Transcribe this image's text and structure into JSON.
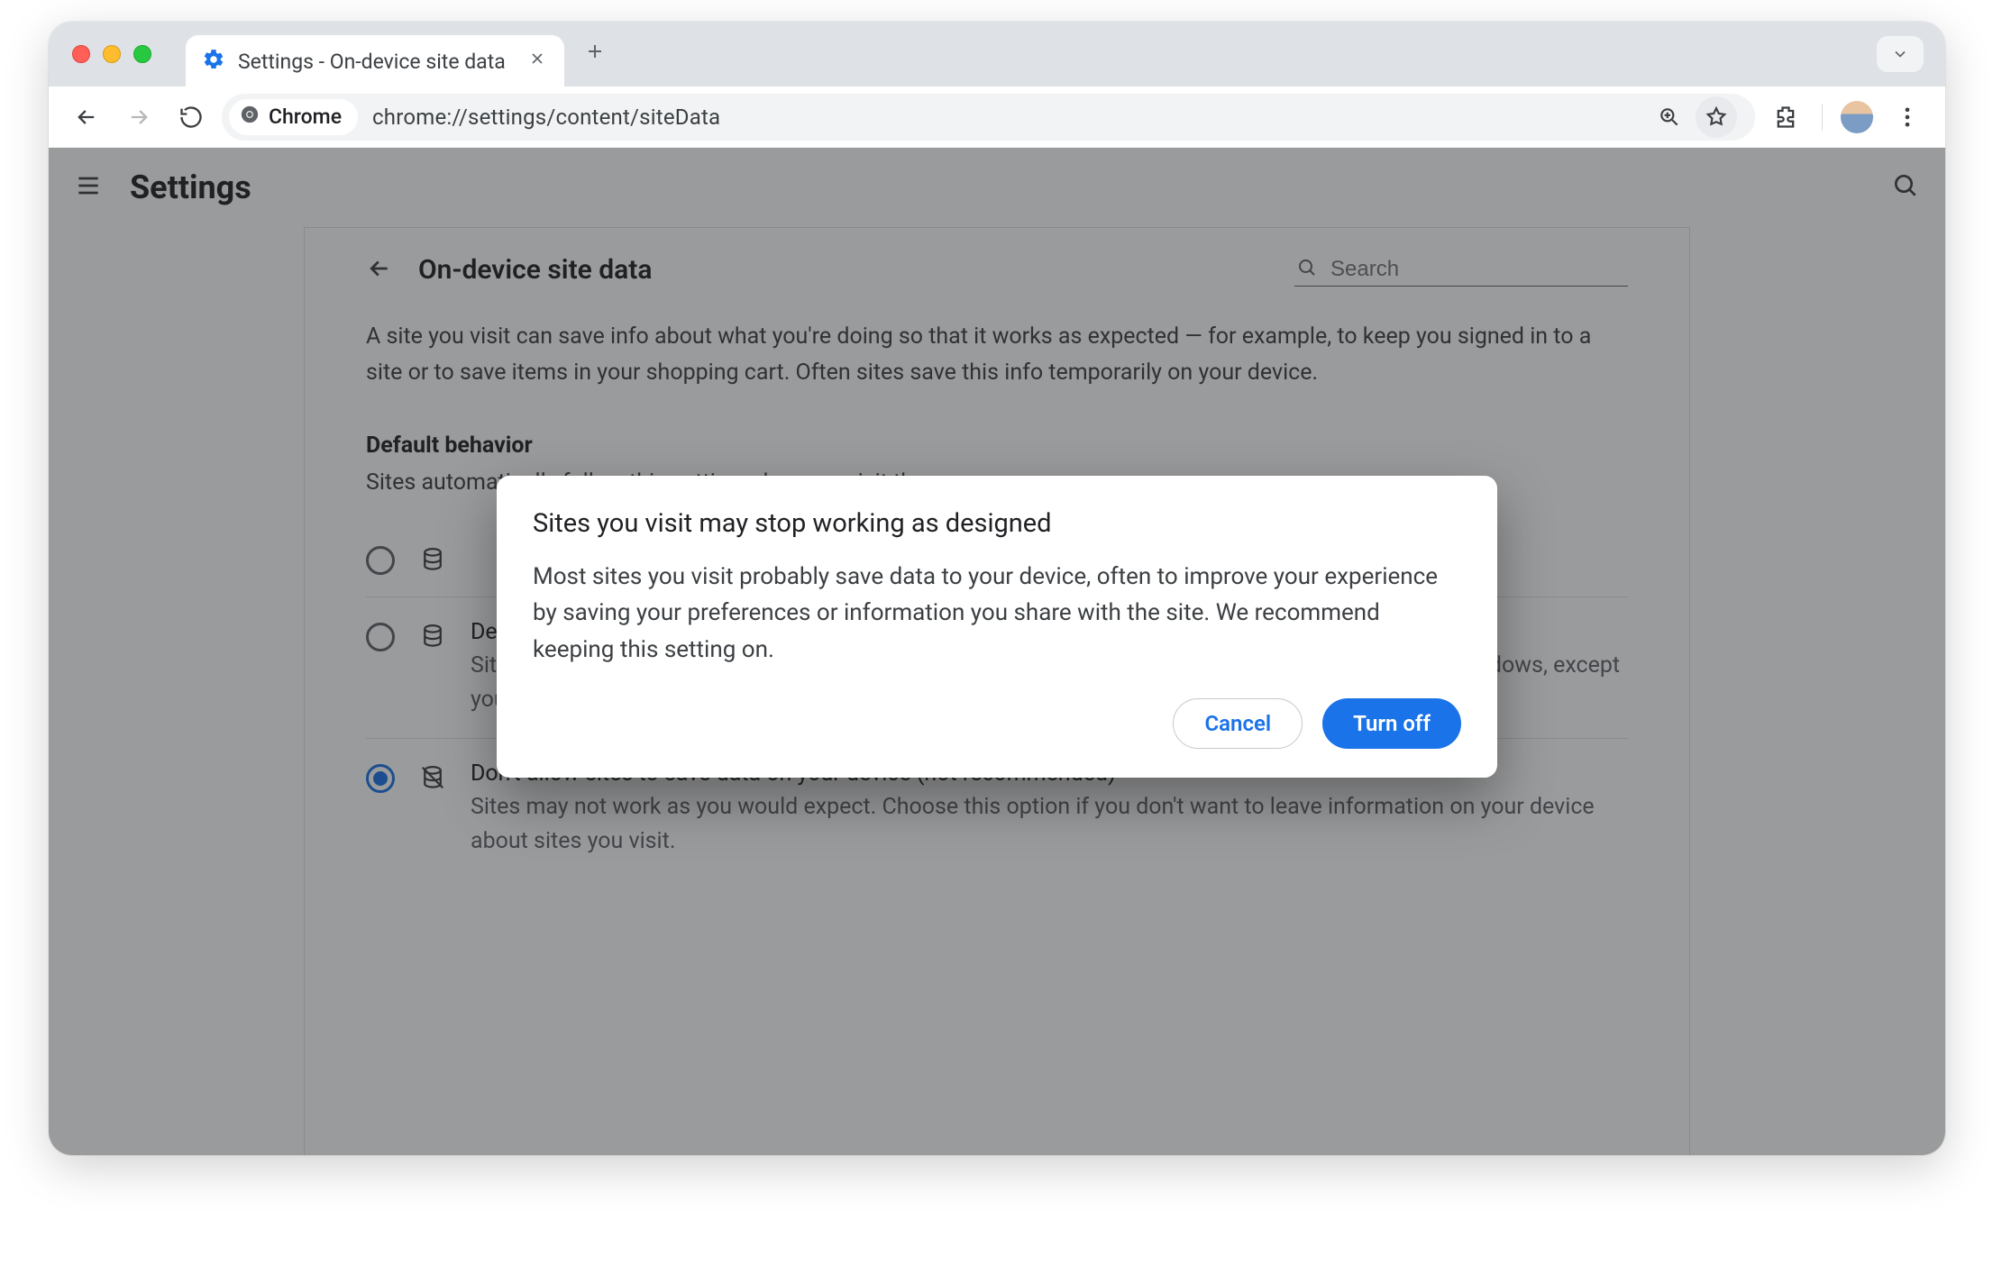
{
  "window": {
    "tab_title": "Settings - On-device site data",
    "url": "chrome://settings/content/siteData",
    "omnibox_chip": "Chrome"
  },
  "appbar": {
    "title": "Settings"
  },
  "page": {
    "title": "On-device site data",
    "search_placeholder": "Search",
    "intro": "A site you visit can save info about what you're doing so that it works as expected — for example, to keep you signed in to a site or to save items in your shopping cart. Often sites save this info temporarily on your device.",
    "default_behavior_label": "Default behavior",
    "default_behavior_help": "Sites automatically follow this setting when you visit them"
  },
  "options": [
    {
      "id": "allow",
      "selected": false,
      "icon": "database",
      "title": "",
      "desc": ""
    },
    {
      "id": "delete-on-close",
      "selected": false,
      "icon": "database",
      "title": "Delete data sites have saved to your device when you close all windows",
      "desc": "Sites will probably work as expected. You'll be signed out of most sites when you close all Chrome windows, except your Google Account if you're signed in to Chrome."
    },
    {
      "id": "block",
      "selected": true,
      "icon": "database-off",
      "title": "Don't allow sites to save data on your device (not recommended)",
      "desc": "Sites may not work as you would expect. Choose this option if you don't want to leave information on your device about sites you visit."
    }
  ],
  "dialog": {
    "title": "Sites you visit may stop working as designed",
    "body": "Most sites you visit probably save data to your device, often to improve your experience by saving your preferences or information you share with the site. We recommend keeping this setting on.",
    "cancel": "Cancel",
    "confirm": "Turn off"
  }
}
